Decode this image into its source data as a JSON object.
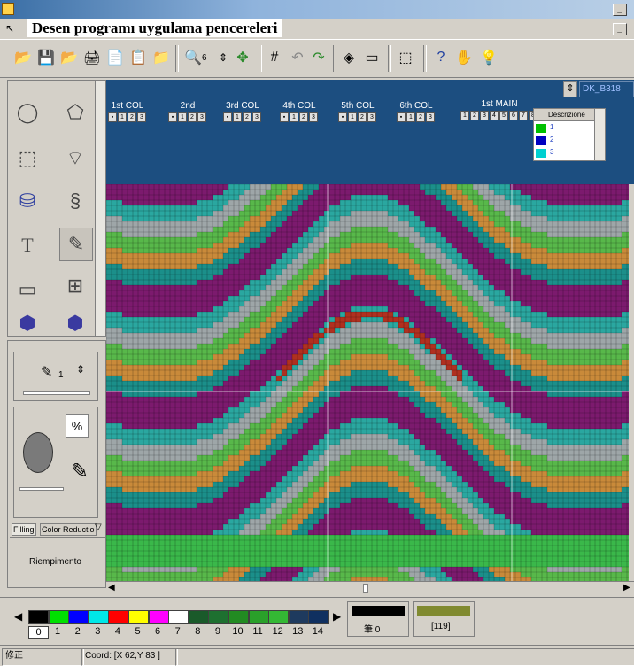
{
  "window": {
    "title_overlay": "Desen programı uygulama pencereleri",
    "minimize_label": "_",
    "close_label": "×"
  },
  "toolbar": {
    "zoom_value": "6"
  },
  "header": {
    "column_groups": [
      {
        "label": "1st COL"
      },
      {
        "label": "2nd"
      },
      {
        "label": "3rd COL"
      },
      {
        "label": "4th COL"
      },
      {
        "label": "5th COL"
      },
      {
        "label": "6th COL"
      }
    ],
    "main_label": "1st MAIN",
    "main_cells": [
      "1",
      "2",
      "3",
      "4",
      "5",
      "6",
      "7",
      "8"
    ],
    "design_field": "DK_B318",
    "description": {
      "header": "Descrizione",
      "rows": [
        {
          "label": "1",
          "color": "#00c000"
        },
        {
          "label": "2",
          "color": "#0000c0"
        },
        {
          "label": "3",
          "color": "#00d0d0"
        }
      ]
    }
  },
  "left_panel": {
    "brush_size": "1",
    "tabs": [
      "Filling",
      "Color Reductio"
    ],
    "panel_label": "Riempimento"
  },
  "palette": {
    "swatches": [
      {
        "n": "0",
        "color": "#000000"
      },
      {
        "n": "1",
        "color": "#00e000"
      },
      {
        "n": "2",
        "color": "#0000ff"
      },
      {
        "n": "3",
        "color": "#00e8e8"
      },
      {
        "n": "4",
        "color": "#ff0000"
      },
      {
        "n": "5",
        "color": "#ffff00"
      },
      {
        "n": "6",
        "color": "#ff00ff"
      },
      {
        "n": "7",
        "color": "#ffffff"
      },
      {
        "n": "8",
        "color": "#1a5a2a"
      },
      {
        "n": "9",
        "color": "#1e7030"
      },
      {
        "n": "10",
        "color": "#228b22"
      },
      {
        "n": "11",
        "color": "#2aa02a"
      },
      {
        "n": "12",
        "color": "#34b834"
      },
      {
        "n": "13",
        "color": "#1e3a5e"
      },
      {
        "n": "14",
        "color": "#103060"
      }
    ],
    "current_color": "#000000",
    "current_label": "筆 0",
    "secondary_color": "#808a30",
    "secondary_label": "[119]"
  },
  "status": {
    "left": "修正",
    "coord": "Coord: [X 62,Y 83 ]"
  }
}
